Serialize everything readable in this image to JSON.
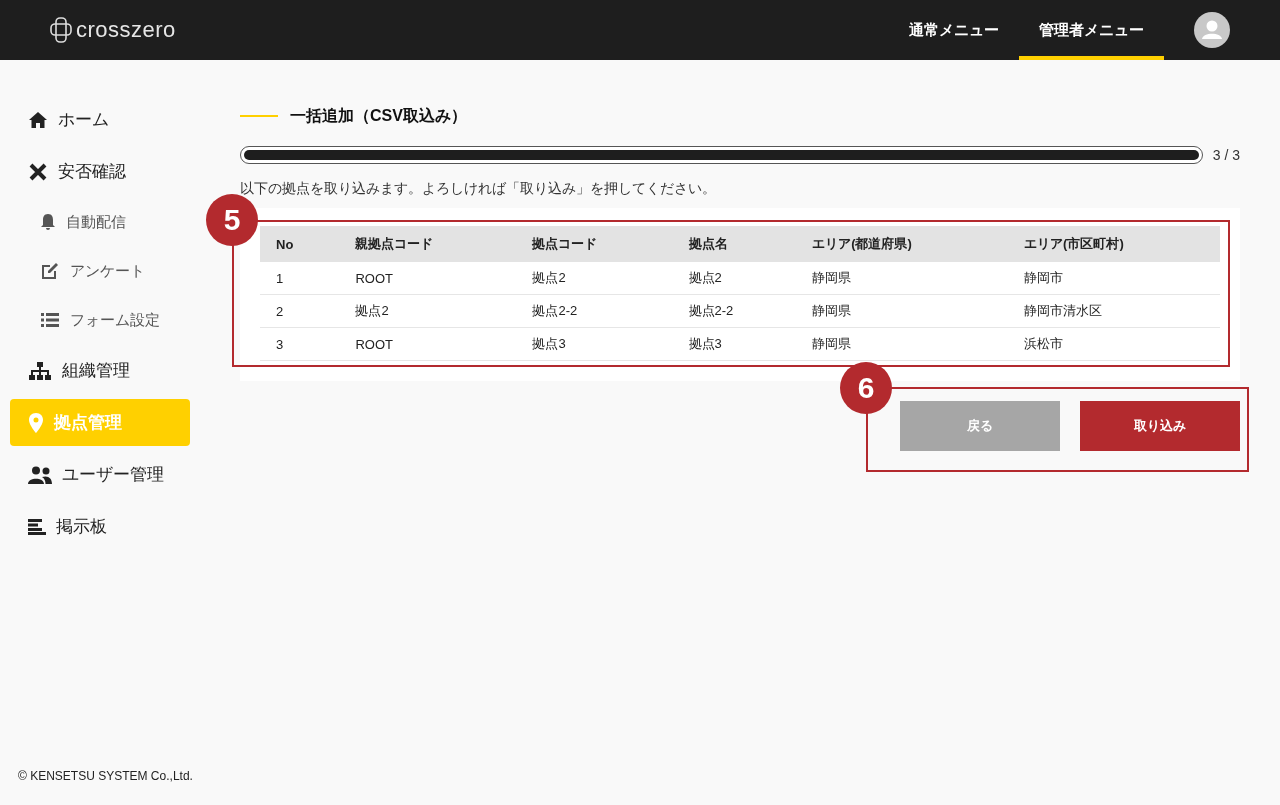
{
  "header": {
    "logo": "crosszero",
    "tabs": [
      {
        "label": "通常メニュー",
        "selected": false
      },
      {
        "label": "管理者メニュー",
        "selected": true
      }
    ]
  },
  "sidebar": {
    "items": [
      {
        "label": "ホーム",
        "selected": false
      },
      {
        "label": "安否確認",
        "selected": false,
        "children": [
          {
            "label": "自動配信",
            "selected": false
          },
          {
            "label": "アンケート",
            "selected": false
          },
          {
            "label": "フォーム設定",
            "selected": false
          }
        ]
      },
      {
        "label": "組織管理",
        "selected": false
      },
      {
        "label": "拠点管理",
        "selected": true
      },
      {
        "label": "ユーザー管理",
        "selected": false
      },
      {
        "label": "掲示板",
        "selected": false
      }
    ]
  },
  "page": {
    "title": "一括追加（CSV取込み）",
    "progress": {
      "level": 1,
      "reading": "3 / 3"
    },
    "message": "以下の拠点を取り込みます。よろしければ「取り込み」を押してください。"
  },
  "table": {
    "columns": [
      "No",
      "親拠点コード",
      "拠点コード",
      "拠点名",
      "エリア(都道府県)",
      "エリア(市区町村)"
    ],
    "rows": [
      [
        "1",
        "ROOT",
        "拠点2",
        "拠点2",
        "静岡県",
        "静岡市"
      ],
      [
        "2",
        "拠点2",
        "拠点2-2",
        "拠点2-2",
        "静岡県",
        "静岡市清水区"
      ],
      [
        "3",
        "ROOT",
        "拠点3",
        "拠点3",
        "静岡県",
        "浜松市"
      ]
    ]
  },
  "buttons": [
    {
      "label": "戻る",
      "kind": "secondary"
    },
    {
      "label": "取り込み",
      "kind": "primary"
    }
  ],
  "callouts": [
    {
      "number": "5"
    },
    {
      "number": "6"
    }
  ],
  "footer": "© KENSETSU SYSTEM Co.,Ltd."
}
